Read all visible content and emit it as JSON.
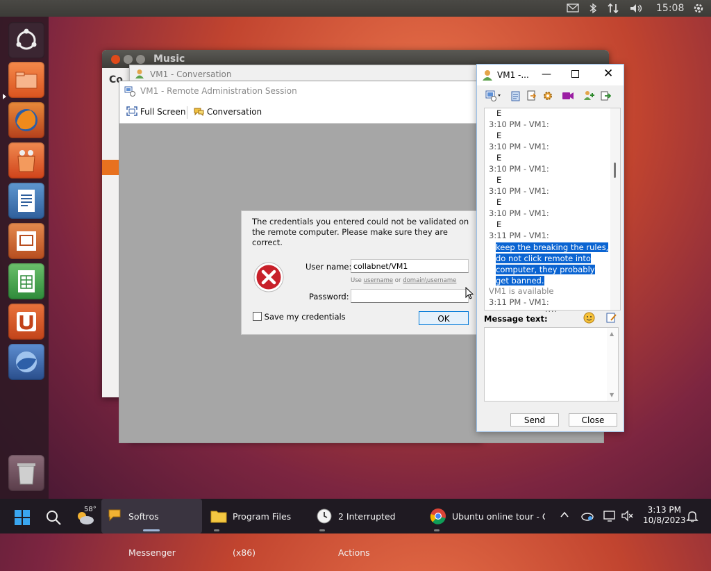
{
  "ubuntu": {
    "clock": "15:08",
    "launcher_items": [
      "ubuntu-logo",
      "files",
      "firefox",
      "software-center",
      "writer",
      "impress",
      "calc",
      "ubuntu-one",
      "thunderbird",
      "trash"
    ]
  },
  "music": {
    "title": "Music",
    "side_label": "Co"
  },
  "conversation_window": {
    "title": "VM1 - Conversation"
  },
  "remote_session": {
    "title": "VM1 - Remote Administration Session",
    "toolbar": {
      "fullscreen": "Full Screen",
      "conversation": "Conversation"
    }
  },
  "credentials_dialog": {
    "message": "The credentials you entered could not be validated on the remote computer. Please make sure they are correct.",
    "username_label": "User name:",
    "username_value": "collabnet/VM1",
    "hint_prefix": "Use ",
    "hint_link1": "username",
    "hint_mid": " or ",
    "hint_link2": "domain\\username",
    "password_label": "Password:",
    "password_value": "",
    "save_label": "Save my credentials",
    "ok_label": "OK"
  },
  "chat": {
    "title": "VM1 -...",
    "message_label": "Message text:",
    "send_label": "Send",
    "close_label": "Close",
    "grip": "....",
    "messages": [
      {
        "text": "E"
      },
      {
        "text": "3:10 PM - VM1:"
      },
      {
        "text": "E"
      },
      {
        "text": "3:10 PM - VM1:"
      },
      {
        "text": "E"
      },
      {
        "text": "3:10 PM - VM1:"
      },
      {
        "text": "E"
      },
      {
        "text": "3:10 PM - VM1:"
      },
      {
        "text": "E"
      },
      {
        "text": "3:10 PM - VM1:"
      },
      {
        "text": "E"
      },
      {
        "text": "3:11 PM - VM1:"
      }
    ],
    "highlighted": [
      "keep the breaking the rules,",
      "do not click remote into",
      "computer, they probably",
      "get banned."
    ],
    "status": "VM1 is available",
    "last": "3:11 PM - VM1:"
  },
  "taskbar": {
    "weather": "58°",
    "apps": [
      {
        "label": "Softros Messenger"
      },
      {
        "label": "Program Files (x86)"
      },
      {
        "label": "2 Interrupted Actions"
      },
      {
        "label": "Ubuntu online tour - Gc"
      }
    ],
    "time": "3:13 PM",
    "date": "10/8/2023"
  },
  "colors": {
    "accent": "#0a64d2",
    "ubuntu_orange": "#dd4814"
  }
}
